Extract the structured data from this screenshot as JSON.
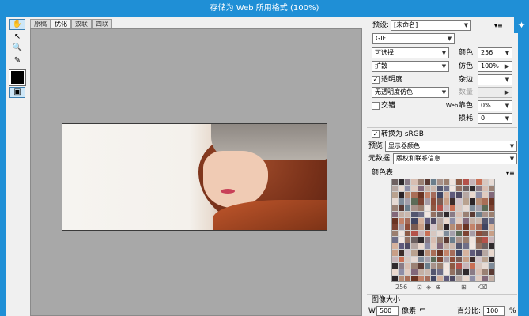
{
  "window": {
    "title": "存储为 Web 所用格式 (100%)"
  },
  "tools": [
    {
      "name": "hand-tool-icon",
      "glyph": "✋"
    },
    {
      "name": "slice-select-tool-icon",
      "glyph": "↖"
    },
    {
      "name": "zoom-tool-icon",
      "glyph": "🔍"
    },
    {
      "name": "eyedropper-tool-icon",
      "glyph": "✎"
    },
    {
      "name": "toggle-slices-icon",
      "glyph": "▣"
    }
  ],
  "tabs": [
    "原稿",
    "优化",
    "双联",
    "四联"
  ],
  "settings": {
    "preset_label": "预设:",
    "preset_value": "[未命名]",
    "format_value": "GIF",
    "reduction_value": "可选择",
    "colors_label": "颜色:",
    "colors_value": "256",
    "dither_algo": "扩散",
    "dither_label": "仿色:",
    "dither_value": "100%",
    "transparency_label": "透明度",
    "transparency_checked": true,
    "matte_label": "杂边:",
    "matte_value": "",
    "trans_dither_value": "无透明度仿色",
    "amount_label": "数量:",
    "amount_value": "",
    "interlaced_label": "交错",
    "interlaced_checked": false,
    "web_snap_prefix": "Web",
    "web_snap_label": "靠色:",
    "web_snap_value": "0%",
    "lossy_label": "损耗:",
    "lossy_value": "0",
    "convert_srgb_label": "转换为 sRGB",
    "convert_srgb_checked": true,
    "preview_label": "预览:",
    "preview_value": "显示器颜色",
    "metadata_label": "元数据:",
    "metadata_value": "版权和联系信息"
  },
  "color_table": {
    "title": "颜色表",
    "count": "256",
    "colors": [
      "#6d6161",
      "#a8928a",
      "#d7c7c0",
      "#8e4c39",
      "#b68d76",
      "#5f5a7b",
      "#c4b0a5",
      "#2f2a2d",
      "#9b7f6f",
      "#e6dad4",
      "#7b5c52",
      "#a96e57",
      "#4e4a63",
      "#cbb8ae",
      "#8a7b86",
      "#efe4de",
      "#7f8c9a",
      "#c89f87",
      "#6a3423",
      "#b6a7a2",
      "#53566f",
      "#d8beb2",
      "#8d5a44",
      "#a5a0ac",
      "#3d2c2a",
      "#c3836a",
      "#e9d8ce",
      "#6f6f88",
      "#9a8174",
      "#b4524a",
      "#5c6b57",
      "#d2c4c9",
      "#a56c5a",
      "#8e8ea6",
      "#f2e7e1",
      "#5a3a33",
      "#c7b4b8",
      "#7d4332",
      "#b9a28f",
      "#404562",
      "#e0cbc0",
      "#927163",
      "#6b7e8c",
      "#c96f54",
      "#a79ca6",
      "#2a2327",
      "#d6b39e",
      "#82687a"
    ]
  },
  "image_size": {
    "title": "图像大小",
    "w_label": "W:",
    "w_value": "500",
    "w_unit": "像素",
    "percent_label": "百分比:",
    "percent_value": "100",
    "percent_unit": "%"
  }
}
